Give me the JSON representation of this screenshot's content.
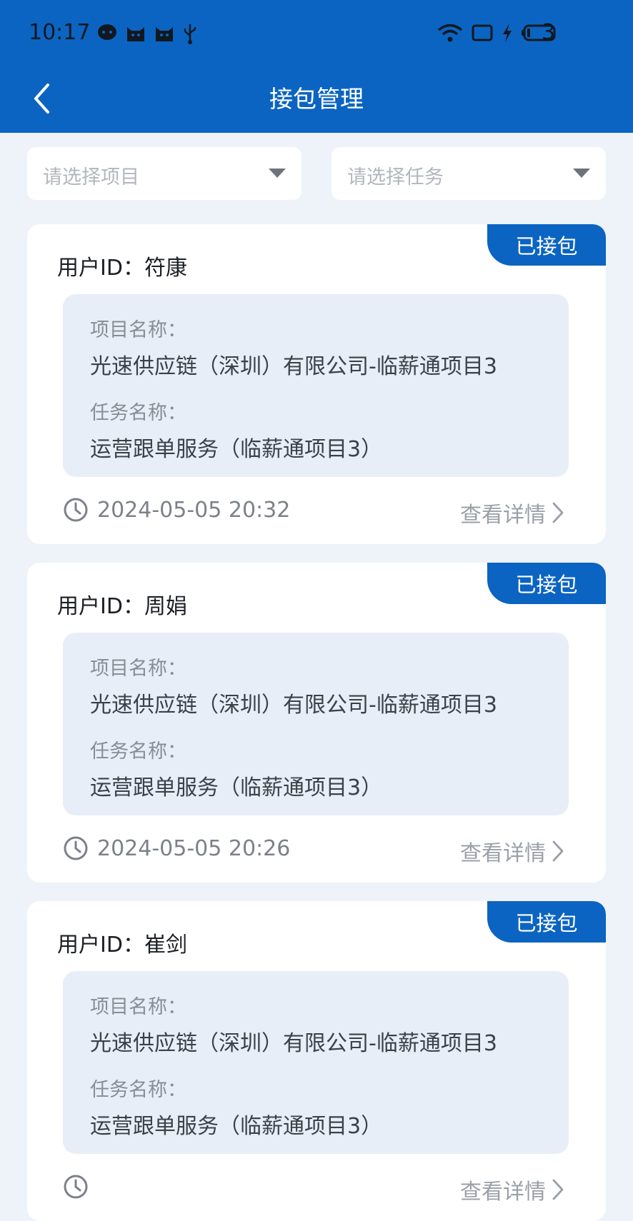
{
  "status_bar": {
    "time": "10:17",
    "battery_level": "3",
    "left_icons": [
      "message-icon",
      "cat-icon",
      "cat-icon",
      "usb-icon"
    ],
    "right_icons": [
      "wifi-icon",
      "screen-icon",
      "charging-icon",
      "battery-icon"
    ]
  },
  "header": {
    "title": "接包管理",
    "background": "#0b64c1"
  },
  "filters": {
    "project_placeholder": "请选择项目",
    "task_placeholder": "请选择任务"
  },
  "cards": [
    {
      "badge": "已接包",
      "user_prefix": "用户ID：",
      "user_name": "符康",
      "project_label": "项目名称：",
      "project_value": "光速供应链（深圳）有限公司-临薪通项目3",
      "task_label": "任务名称：",
      "task_value": "运营跟单服务（临薪通项目3）",
      "timestamp": "2024-05-05 20:32",
      "detail_label": "查看详情"
    },
    {
      "badge": "已接包",
      "user_prefix": "用户ID：",
      "user_name": "周娟",
      "project_label": "项目名称：",
      "project_value": "光速供应链（深圳）有限公司-临薪通项目3",
      "task_label": "任务名称：",
      "task_value": "运营跟单服务（临薪通项目3）",
      "timestamp": "2024-05-05 20:26",
      "detail_label": "查看详情"
    },
    {
      "badge": "已接包",
      "user_prefix": "用户ID：",
      "user_name": "崔剑",
      "project_label": "项目名称：",
      "project_value": "光速供应链（深圳）有限公司-临薪通项目3",
      "task_label": "任务名称：",
      "task_value": "运营跟单服务（临薪通项目3）",
      "timestamp": "",
      "detail_label": "查看详情"
    }
  ]
}
